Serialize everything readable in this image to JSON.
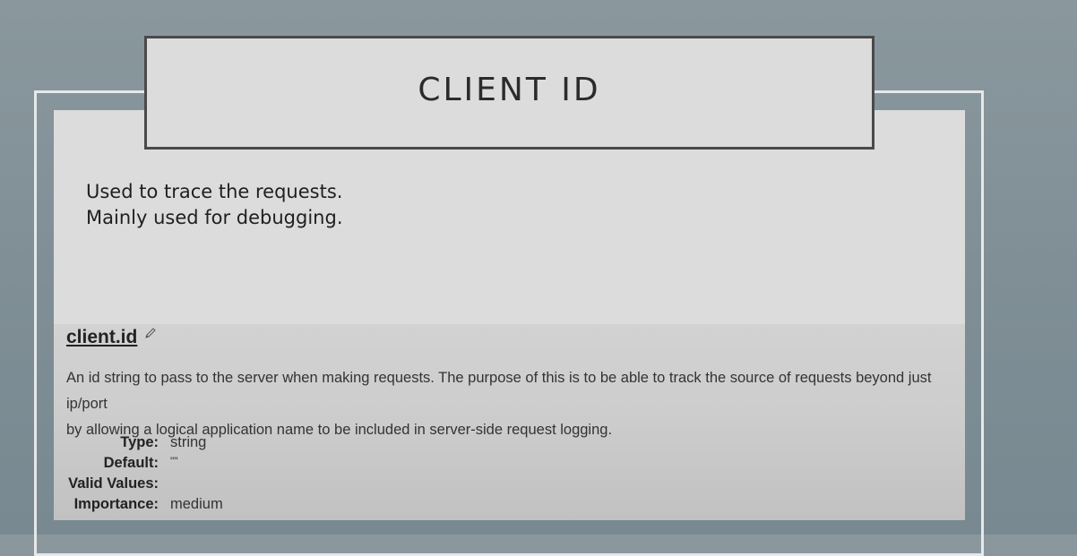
{
  "slide": {
    "title": "CLIENT ID",
    "bullets": [
      "Used to trace the requests.",
      "Mainly used for debugging."
    ]
  },
  "doc": {
    "property_name": "client.id",
    "edit_icon": "pencil-icon",
    "description_lines": [
      "An id string to pass to the server when making requests. The purpose of this is to be able to track the source of requests beyond just ip/port",
      "by allowing a logical application name to be included in server-side request logging."
    ],
    "meta": {
      "type_label": "Type:",
      "type_value": "string",
      "default_label": "Default:",
      "default_value": "\"\"",
      "valid_values_label": "Valid Values:",
      "valid_values_value": "",
      "importance_label": "Importance:",
      "importance_value": "medium"
    }
  }
}
